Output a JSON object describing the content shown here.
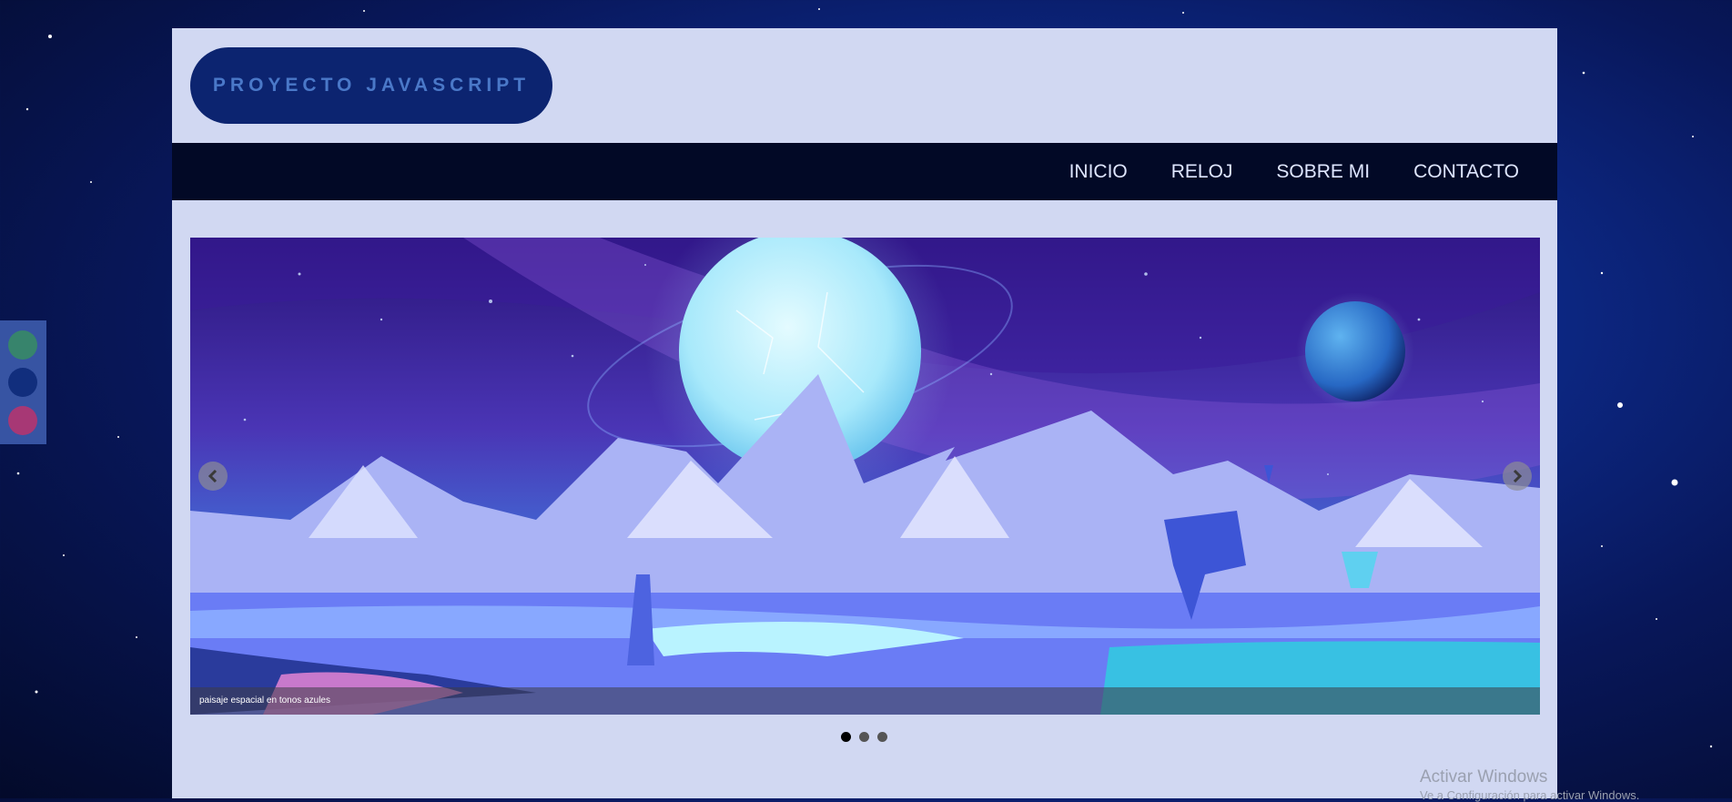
{
  "header": {
    "logo_text": "PROYECTO JAVASCRIPT"
  },
  "nav": {
    "items": [
      {
        "label": "INICIO"
      },
      {
        "label": "RELOJ"
      },
      {
        "label": "SOBRE MI"
      },
      {
        "label": "CONTACTO"
      }
    ]
  },
  "carousel": {
    "caption": "paisaje espacial en tonos azules",
    "slide_count": 3,
    "active_slide": 1
  },
  "theme_switcher": {
    "swatches": [
      {
        "name": "green",
        "color": "#3a8a6e"
      },
      {
        "name": "blue",
        "color": "#123080"
      },
      {
        "name": "pink",
        "color": "#b03a78"
      }
    ]
  },
  "watermark": {
    "title": "Activar Windows",
    "subtitle": "Ve a Configuración para activar Windows."
  },
  "colors": {
    "page_bg": "#d1d8f2",
    "nav_bg": "#020926",
    "logo_bg": "#0c2470",
    "logo_text": "#4a78c8"
  }
}
